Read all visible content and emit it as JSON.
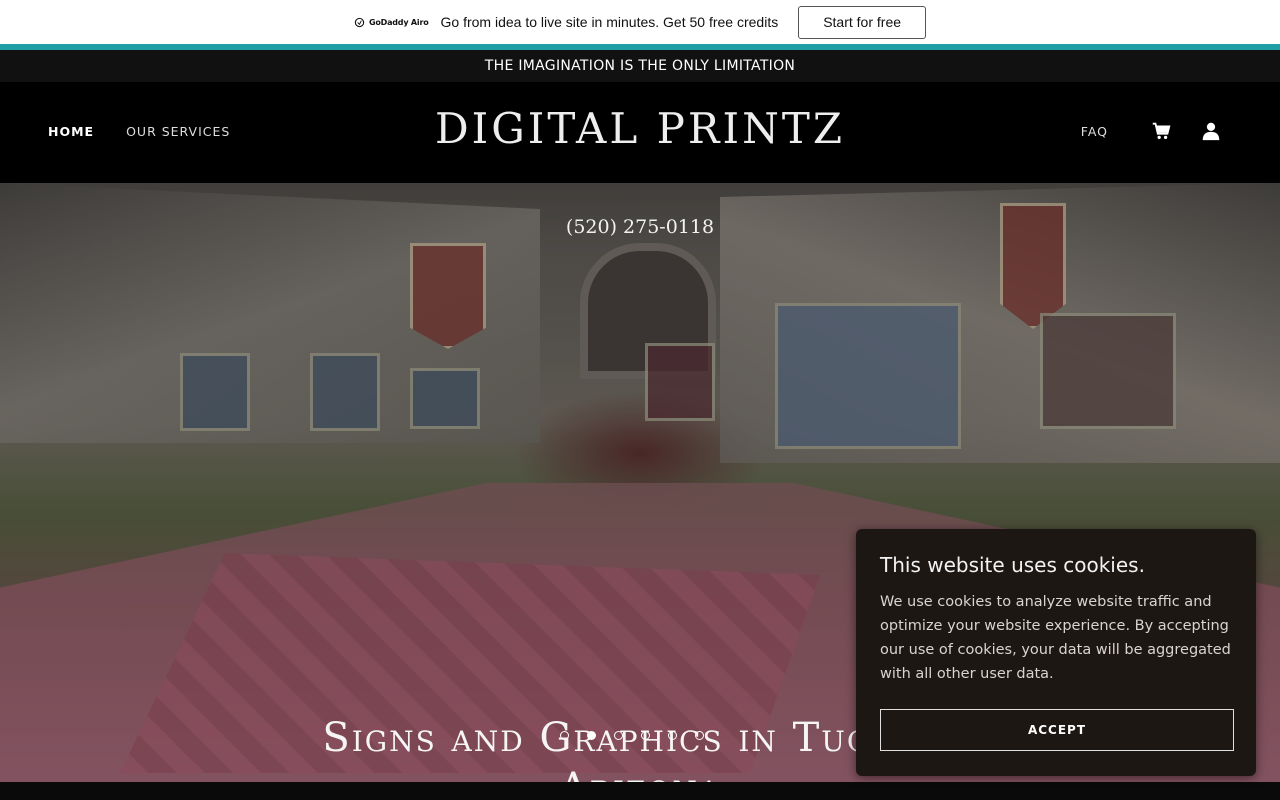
{
  "promo": {
    "logo_text": "GoDaddy Airo",
    "message": "Go from idea to live site in minutes. Get 50 free credits",
    "cta": "Start for free",
    "accent_color": "#1f9ea6"
  },
  "tagline": "THE IMAGINATION IS THE ONLY LIMITATION",
  "nav": {
    "brand": "DIGITAL PRINTZ",
    "items": [
      {
        "label": "HOME",
        "active": true
      },
      {
        "label": "OUR SERVICES",
        "active": false
      }
    ],
    "faq": "FAQ",
    "icons": [
      "cart-icon",
      "account-icon"
    ]
  },
  "hero": {
    "phone": "(520) 275-0118",
    "title": "Signs and Graphics in Tucson, Arizona",
    "slides": 6,
    "active_slide": 2
  },
  "cookie": {
    "title": "This website uses cookies.",
    "body": "We use cookies to analyze website traffic and optimize your website experience. By accepting our use of cookies, your data will be aggregated with all other user data.",
    "accept": "ACCEPT"
  }
}
